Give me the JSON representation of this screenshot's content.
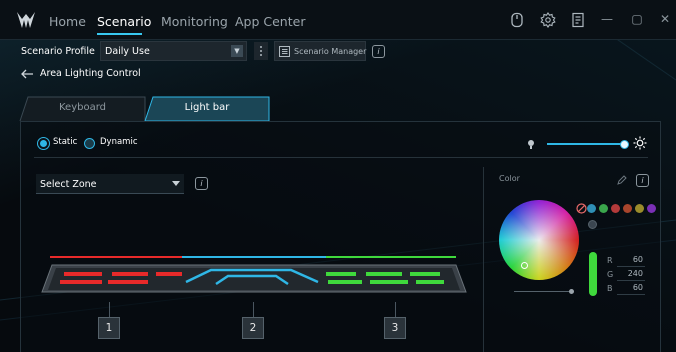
{
  "nav": {
    "tabs": [
      {
        "label": "Home"
      },
      {
        "label": "Scenario"
      },
      {
        "label": "Monitoring"
      },
      {
        "label": "App Center"
      }
    ],
    "active_tab": "Scenario"
  },
  "profile": {
    "label": "Scenario Profile",
    "selected": "Daily Use",
    "manager_label": "Scenario Manager"
  },
  "page": {
    "title": "Area Lighting Control"
  },
  "device_tabs": [
    {
      "label": "Keyboard"
    },
    {
      "label": "Light bar"
    }
  ],
  "lighting": {
    "mode_static": "Static",
    "mode_dynamic": "Dynamic",
    "selected_mode": "Static",
    "brightness_level": 1.0,
    "zone_select_label": "Select Zone",
    "zones": [
      {
        "label": "1",
        "color": "#e82a2a"
      },
      {
        "label": "2",
        "color": "#2fb7e6"
      },
      {
        "label": "3",
        "color": "#3fd93c"
      }
    ]
  },
  "color_panel": {
    "label": "Color",
    "swatches": [
      "#2f8fb5",
      "#3aa64c",
      "#b33a3a",
      "#a8452c",
      "#9a8c2b",
      "#7a2fb5"
    ],
    "r_label": "R",
    "g_label": "G",
    "b_label": "B",
    "r": "60",
    "g": "240",
    "b": "60",
    "accent": "#2fb7e6"
  },
  "icons": [
    "predator-logo-icon",
    "controller-icon",
    "settings-gear-icon",
    "panel-icon",
    "minimize-icon",
    "maximize-icon",
    "close-icon",
    "back-arrow-icon",
    "info-icon",
    "eyedropper-icon",
    "brightness-low-icon",
    "brightness-high-icon"
  ]
}
